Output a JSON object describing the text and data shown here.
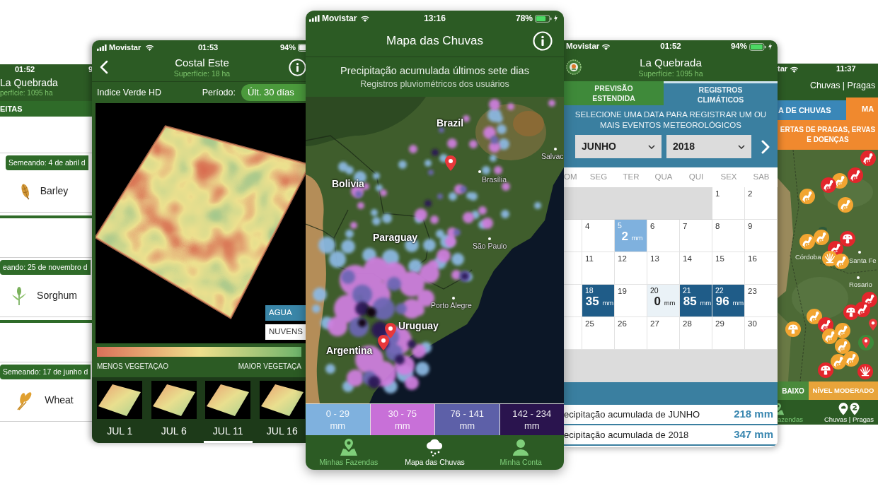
{
  "crop_list_screen": {
    "status_bar": {
      "time": "01:52",
      "battery": "9"
    },
    "header": {
      "title": "La Quebrada",
      "subtitle": "perfície: 1095 ha"
    },
    "tab": "EITAS",
    "crops": [
      {
        "sown": "Semeando: 4 de abril d",
        "name": "Barley",
        "kind": "barley"
      },
      {
        "sown": "eando: 25 de novembro d",
        "name": "Sorghum",
        "kind": "sorghum"
      },
      {
        "sown": "Semeando: 17 de junho d",
        "name": "Wheat",
        "kind": "wheat"
      }
    ]
  },
  "index_screen": {
    "status_bar": {
      "carrier": "Movistar",
      "time": "01:53",
      "battery": "94%"
    },
    "header": {
      "title": "Costal Este",
      "subtitle": "Superfície: 18 ha"
    },
    "toolbar": {
      "label": "Indice Verde HD",
      "period_label": "Período:",
      "period": "Últ. 30 días"
    },
    "layers": [
      {
        "label": "AGUA",
        "selected": true
      },
      {
        "label": "NUVENS",
        "selected": false
      }
    ],
    "legend": {
      "low": "MENOS VEGETAÇAO",
      "high": "MAIOR VEGETAÇA"
    },
    "dates": [
      {
        "label": "JUL 1",
        "selected": false
      },
      {
        "label": "JUL 6",
        "selected": false
      },
      {
        "label": "JUL 11",
        "selected": true
      },
      {
        "label": "JUL 16",
        "selected": false
      }
    ]
  },
  "rain_map_screen": {
    "status_bar": {
      "carrier": "Movistar",
      "time": "13:16",
      "battery": "78%"
    },
    "header": {
      "title": "Mapa das Chuvas"
    },
    "summary": {
      "title": "Precipitação acumulada últimos sete dias",
      "subtitle": "Registros pluviométricos dos usuários"
    },
    "map_labels": [
      {
        "text": "Brazil",
        "kind": "country"
      },
      {
        "text": "Salvac",
        "kind": "city"
      },
      {
        "text": "Brasília",
        "kind": "city"
      },
      {
        "text": "Bolivia",
        "kind": "country"
      },
      {
        "text": "Paraguay",
        "kind": "country"
      },
      {
        "text": "São Paulo",
        "kind": "city"
      },
      {
        "text": "Porto Alegre",
        "kind": "city"
      },
      {
        "text": "Uruguay",
        "kind": "country"
      },
      {
        "text": "Argentina",
        "kind": "country"
      }
    ],
    "legend": [
      {
        "range": "0 - 29",
        "unit": "mm",
        "color": "#7fb1de"
      },
      {
        "range": "30 - 75",
        "unit": "mm",
        "color": "#c870d8"
      },
      {
        "range": "76 - 141",
        "unit": "mm",
        "color": "#5d60a8"
      },
      {
        "range": "142 - 234",
        "unit": "mm",
        "color": "#2a144e"
      }
    ],
    "nav": [
      {
        "label": "Minhas Fazendas",
        "kind": "farm",
        "selected": false
      },
      {
        "label": "Mapa das Chuvas",
        "kind": "rain",
        "selected": true
      },
      {
        "label": "Minha Conta",
        "kind": "account",
        "selected": false
      }
    ]
  },
  "climate_screen": {
    "status_bar": {
      "carrier": "Movistar",
      "time": "01:52",
      "battery": "94%"
    },
    "header": {
      "title": "La Quebrada",
      "subtitle": "Superfície: 1095 ha"
    },
    "tabs": [
      {
        "label": "PREVISÃO ESTENDIDA",
        "selected": false
      },
      {
        "label": "REGISTROS CLIMÁTICOS",
        "selected": true
      }
    ],
    "instruction": "SELECIONE UMA DATA PARA REGISTRAR UM OU MAIS EVENTOS METEOROLÓGICOS",
    "month": "JUNHO",
    "year": "2018",
    "weekdays": [
      "OM",
      "SEG",
      "TER",
      "QUA",
      "QUI",
      "SEX",
      "SAB"
    ],
    "weeks": [
      [
        {
          "kind": "outside"
        },
        {
          "kind": "outside"
        },
        {
          "kind": "outside"
        },
        {
          "kind": "outside"
        },
        {
          "kind": "outside"
        },
        {
          "kind": "day",
          "day": "1"
        },
        {
          "kind": "day",
          "day": "2"
        }
      ],
      [
        {
          "kind": "blank"
        },
        {
          "kind": "day",
          "day": "4"
        },
        {
          "kind": "rain",
          "day": "5",
          "amount": "2",
          "unit": "mm",
          "color": "#7fb1de"
        },
        {
          "kind": "day",
          "day": "6"
        },
        {
          "kind": "day",
          "day": "7"
        },
        {
          "kind": "day",
          "day": "8"
        },
        {
          "kind": "day",
          "day": "9"
        }
      ],
      [
        {
          "kind": "blank"
        },
        {
          "kind": "day",
          "day": "11"
        },
        {
          "kind": "day",
          "day": "12"
        },
        {
          "kind": "day",
          "day": "13"
        },
        {
          "kind": "day",
          "day": "14"
        },
        {
          "kind": "day",
          "day": "15"
        },
        {
          "kind": "day",
          "day": "16"
        }
      ],
      [
        {
          "kind": "blank"
        },
        {
          "kind": "rain",
          "day": "18",
          "amount": "35",
          "unit": "mm",
          "color": "#1f5c88"
        },
        {
          "kind": "day",
          "day": "19"
        },
        {
          "kind": "rain",
          "day": "20",
          "amount": "0",
          "unit": "mm",
          "color": "#eaf2f7"
        },
        {
          "kind": "rain",
          "day": "21",
          "amount": "85",
          "unit": "mm",
          "color": "#1f5c88"
        },
        {
          "kind": "rain",
          "day": "22",
          "amount": "96",
          "unit": "mm",
          "color": "#1f5c88"
        },
        {
          "kind": "day",
          "day": "23"
        }
      ],
      [
        {
          "kind": "blank"
        },
        {
          "kind": "day",
          "day": "25"
        },
        {
          "kind": "day",
          "day": "26"
        },
        {
          "kind": "day",
          "day": "27"
        },
        {
          "kind": "day",
          "day": "28"
        },
        {
          "kind": "day",
          "day": "29"
        },
        {
          "kind": "day",
          "day": "30"
        }
      ]
    ],
    "totals": [
      {
        "label": "ecipitação acumulada de JUNHO",
        "value": "218 mm"
      },
      {
        "label": "ecipitação acumulada de 2018",
        "value": "347 mm"
      }
    ]
  },
  "pest_screen": {
    "status_bar": {
      "carrier": "tar",
      "time": "11:37"
    },
    "header": {
      "title": "Chuvas | Pragas"
    },
    "tabs": [
      {
        "label": "A DE CHUVAS",
        "selected": false
      },
      {
        "label": "MA",
        "selected": true
      }
    ],
    "banner": "ERTAS DE PRAGAS, ERVAS E DOENÇAS",
    "map_labels": [
      {
        "text": "Córdoba",
        "kind": "town"
      },
      {
        "text": "Santa Fe",
        "kind": "city"
      },
      {
        "text": "Rosario",
        "kind": "city"
      }
    ],
    "markers": [
      {
        "kind": "worm",
        "color": "#e3262c"
      },
      {
        "kind": "worm",
        "color": "#e3262c"
      },
      {
        "kind": "worm",
        "color": "#f2a531"
      },
      {
        "kind": "worm",
        "color": "#e3262c"
      },
      {
        "kind": "worm",
        "color": "#f2a531"
      },
      {
        "kind": "worm",
        "color": "#f2a531"
      },
      {
        "kind": "fungus",
        "color": "#e3262c"
      },
      {
        "kind": "worm",
        "color": "#f2a531"
      },
      {
        "kind": "worm",
        "color": "#f2a531"
      },
      {
        "kind": "worm",
        "color": "#e3262c"
      },
      {
        "kind": "weed",
        "color": "#f2a531"
      },
      {
        "kind": "worm",
        "color": "#f2a531"
      },
      {
        "kind": "worm",
        "color": "#e3262c"
      },
      {
        "kind": "fungus",
        "color": "#e3262c"
      },
      {
        "kind": "worm",
        "color": "#e3262c"
      },
      {
        "kind": "worm",
        "color": "#f2a531"
      },
      {
        "kind": "fungus",
        "color": "#f2a531"
      },
      {
        "kind": "worm",
        "color": "#e3262c"
      },
      {
        "kind": "worm",
        "color": "#f2a531"
      },
      {
        "kind": "worm",
        "color": "#f2a531"
      },
      {
        "kind": "worm",
        "color": "#f2a531"
      },
      {
        "kind": "worm",
        "color": "#f2a531"
      },
      {
        "kind": "worm",
        "color": "#f2a531"
      },
      {
        "kind": "fungus",
        "color": "#e3262c"
      },
      {
        "kind": "weed",
        "color": "#e3262c"
      }
    ],
    "severity": [
      {
        "label": "BAIXO",
        "color": "#4a8a3b"
      },
      {
        "label": "NÍVEL MODERADO",
        "color": "#e8a43a"
      }
    ],
    "nav": [
      {
        "label": "azendas",
        "kind": "farm",
        "selected": false
      },
      {
        "label": "Chuvas | Pragas",
        "kind": "alerts",
        "selected": true
      }
    ]
  }
}
